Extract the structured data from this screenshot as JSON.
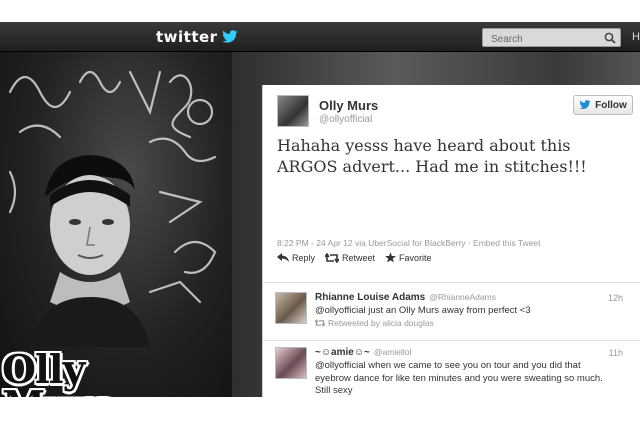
{
  "topbar": {
    "logo_text": "twitter",
    "search_placeholder": "Search",
    "overflow_letter": "H"
  },
  "overlay": {
    "line1": "Olly",
    "line2": "Murs"
  },
  "tweet": {
    "author_name": "Olly Murs",
    "author_handle": "@ollyofficial",
    "follow_label": "Follow",
    "text": "Hahaha yesss have heard about this ARGOS advert... Had me in stitches!!!",
    "meta": "8:22 PM - 24 Apr 12 via UberSocial for BlackBerry · Embed this Tweet",
    "actions": {
      "reply": "Reply",
      "retweet": "Retweet",
      "favorite": "Favorite"
    }
  },
  "replies": [
    {
      "name": "Rhianne Louise Adams",
      "handle": "@RhianneAdams",
      "time": "12h",
      "text": "@ollyofficial just an Olly Murs away from perfect <3",
      "retweeted_by": "Retweeted by alicia douglas"
    },
    {
      "name": "~☺amie☺~",
      "handle": "@amiellol",
      "time": "11h",
      "text": "@ollyofficial when we came to see you on tour and you did that eyebrow dance for like ten minutes and you were sweating so much. Still sexy"
    }
  ],
  "colors": {
    "topbar": "#2b2b2b",
    "twitter_blue": "#33ccff",
    "follow_bird": "#1d8dd6"
  }
}
